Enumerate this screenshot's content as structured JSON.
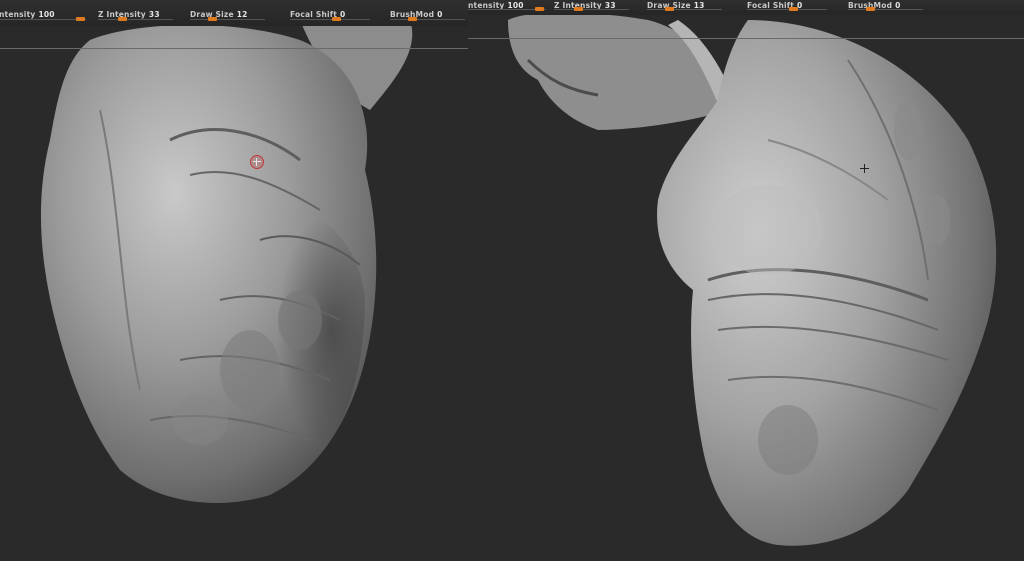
{
  "left_view": {
    "sliders": [
      {
        "label": "Intensity",
        "prefix": "",
        "value": "100",
        "level": 1.0
      },
      {
        "label": "Z Intensity",
        "prefix": "",
        "value": "33",
        "level": 0.33
      },
      {
        "label": "Draw Size",
        "prefix": "",
        "value": "12",
        "level": 0.12
      },
      {
        "label": "Focal Shift",
        "prefix": "",
        "value": "0",
        "level": 0.5
      },
      {
        "label": "BrushMod",
        "prefix": "",
        "value": "0",
        "level": 0.5
      }
    ]
  },
  "right_view": {
    "sliders": [
      {
        "label": "ntensity",
        "value": "100",
        "level": 1.0
      },
      {
        "label": "Z Intensity",
        "value": "33",
        "level": 0.33
      },
      {
        "label": "Draw Size",
        "value": "13",
        "level": 0.13
      },
      {
        "label": "Focal Shift",
        "value": "0",
        "level": 0.5
      },
      {
        "label": "BrushMod",
        "value": "0",
        "level": 0.5
      }
    ]
  },
  "colors": {
    "accent": "#e07a1f",
    "background": "#2a2a2a",
    "clay": "#9a9a9a"
  }
}
